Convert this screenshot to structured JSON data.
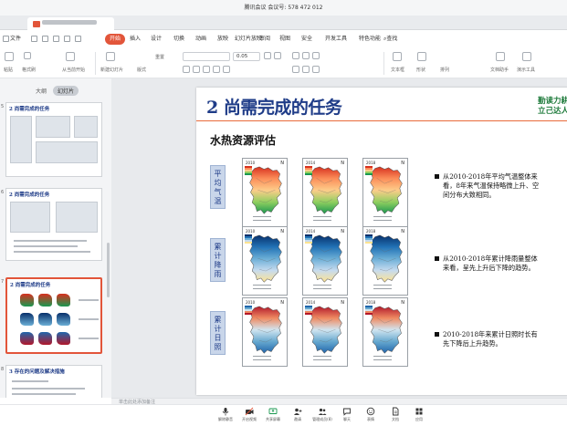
{
  "meeting": {
    "title": "腾讯会议 会议号: 578 472 012"
  },
  "menu": {
    "file": "文件",
    "items": [
      "开始",
      "插入",
      "设计",
      "切换",
      "动画",
      "放映",
      "幻灯片放映",
      "审阅",
      "视图",
      "安全",
      "开发工具",
      "特色功能"
    ],
    "active_index": 0,
    "search": "查找"
  },
  "ribbon": {
    "labels": [
      "粘贴",
      "格式刷",
      "从当前开始",
      "新建幻灯片",
      "版式",
      "重置"
    ],
    "font_size": "0.05",
    "right_labels": [
      "文本框",
      "形状",
      "排列",
      "文档助手",
      "演示工具"
    ]
  },
  "sidebar": {
    "outline": "大纲",
    "slides": "幻灯片",
    "thumbs": [
      {
        "num": "5",
        "title": "2 尚需完成的任务"
      },
      {
        "num": "6",
        "title": "2 尚需完成的任务"
      },
      {
        "num": "7",
        "title": "2 尚需完成的任务"
      },
      {
        "num": "8",
        "title": "3 存在的问题及解决措施"
      }
    ],
    "active_index": 2
  },
  "slide": {
    "title": "2 尚需完成的任务",
    "motto_line1": "勤读力耕",
    "motto_line2": "立己达人",
    "subtitle": "水热资源评估",
    "rows": [
      {
        "label": "平均气温",
        "years": [
          "2010",
          "2014",
          "2018"
        ],
        "palette": "temp"
      },
      {
        "label": "累计降雨",
        "years": [
          "2010",
          "2014",
          "2018"
        ],
        "palette": "rain"
      },
      {
        "label": "累计日照",
        "years": [
          "2010",
          "2014",
          "2018"
        ],
        "palette": "sun"
      }
    ],
    "bullets": [
      "从2010-2018年平均气温整体来看，8年来气温保持略微上升、空间分布大致相同。",
      "从2010-2018年累计降雨量整体来看，呈先上升后下降的趋势。",
      "2010-2018年来累计日照时长有先下降后上升趋势。"
    ],
    "north": "N"
  },
  "notes": {
    "placeholder": "单击此处添加备注"
  },
  "toolbar": {
    "items": [
      {
        "label": "解除静音",
        "icon": "mic-icon"
      },
      {
        "label": "开启视频",
        "icon": "camera-icon"
      },
      {
        "label": "共享屏幕",
        "icon": "share-screen-icon"
      },
      {
        "label": "邀请",
        "icon": "invite-icon"
      },
      {
        "label": "管理成员(8)",
        "icon": "members-icon"
      },
      {
        "label": "聊天",
        "icon": "chat-icon"
      },
      {
        "label": "表情",
        "icon": "emoji-icon"
      },
      {
        "label": "文档",
        "icon": "document-icon"
      },
      {
        "label": "应用",
        "icon": "apps-icon"
      }
    ]
  },
  "colors": {
    "accent": "#e2553a",
    "title_blue": "#1f3c88",
    "motto_green": "#1d7a3a",
    "label_bg": "#c9d6ea"
  }
}
